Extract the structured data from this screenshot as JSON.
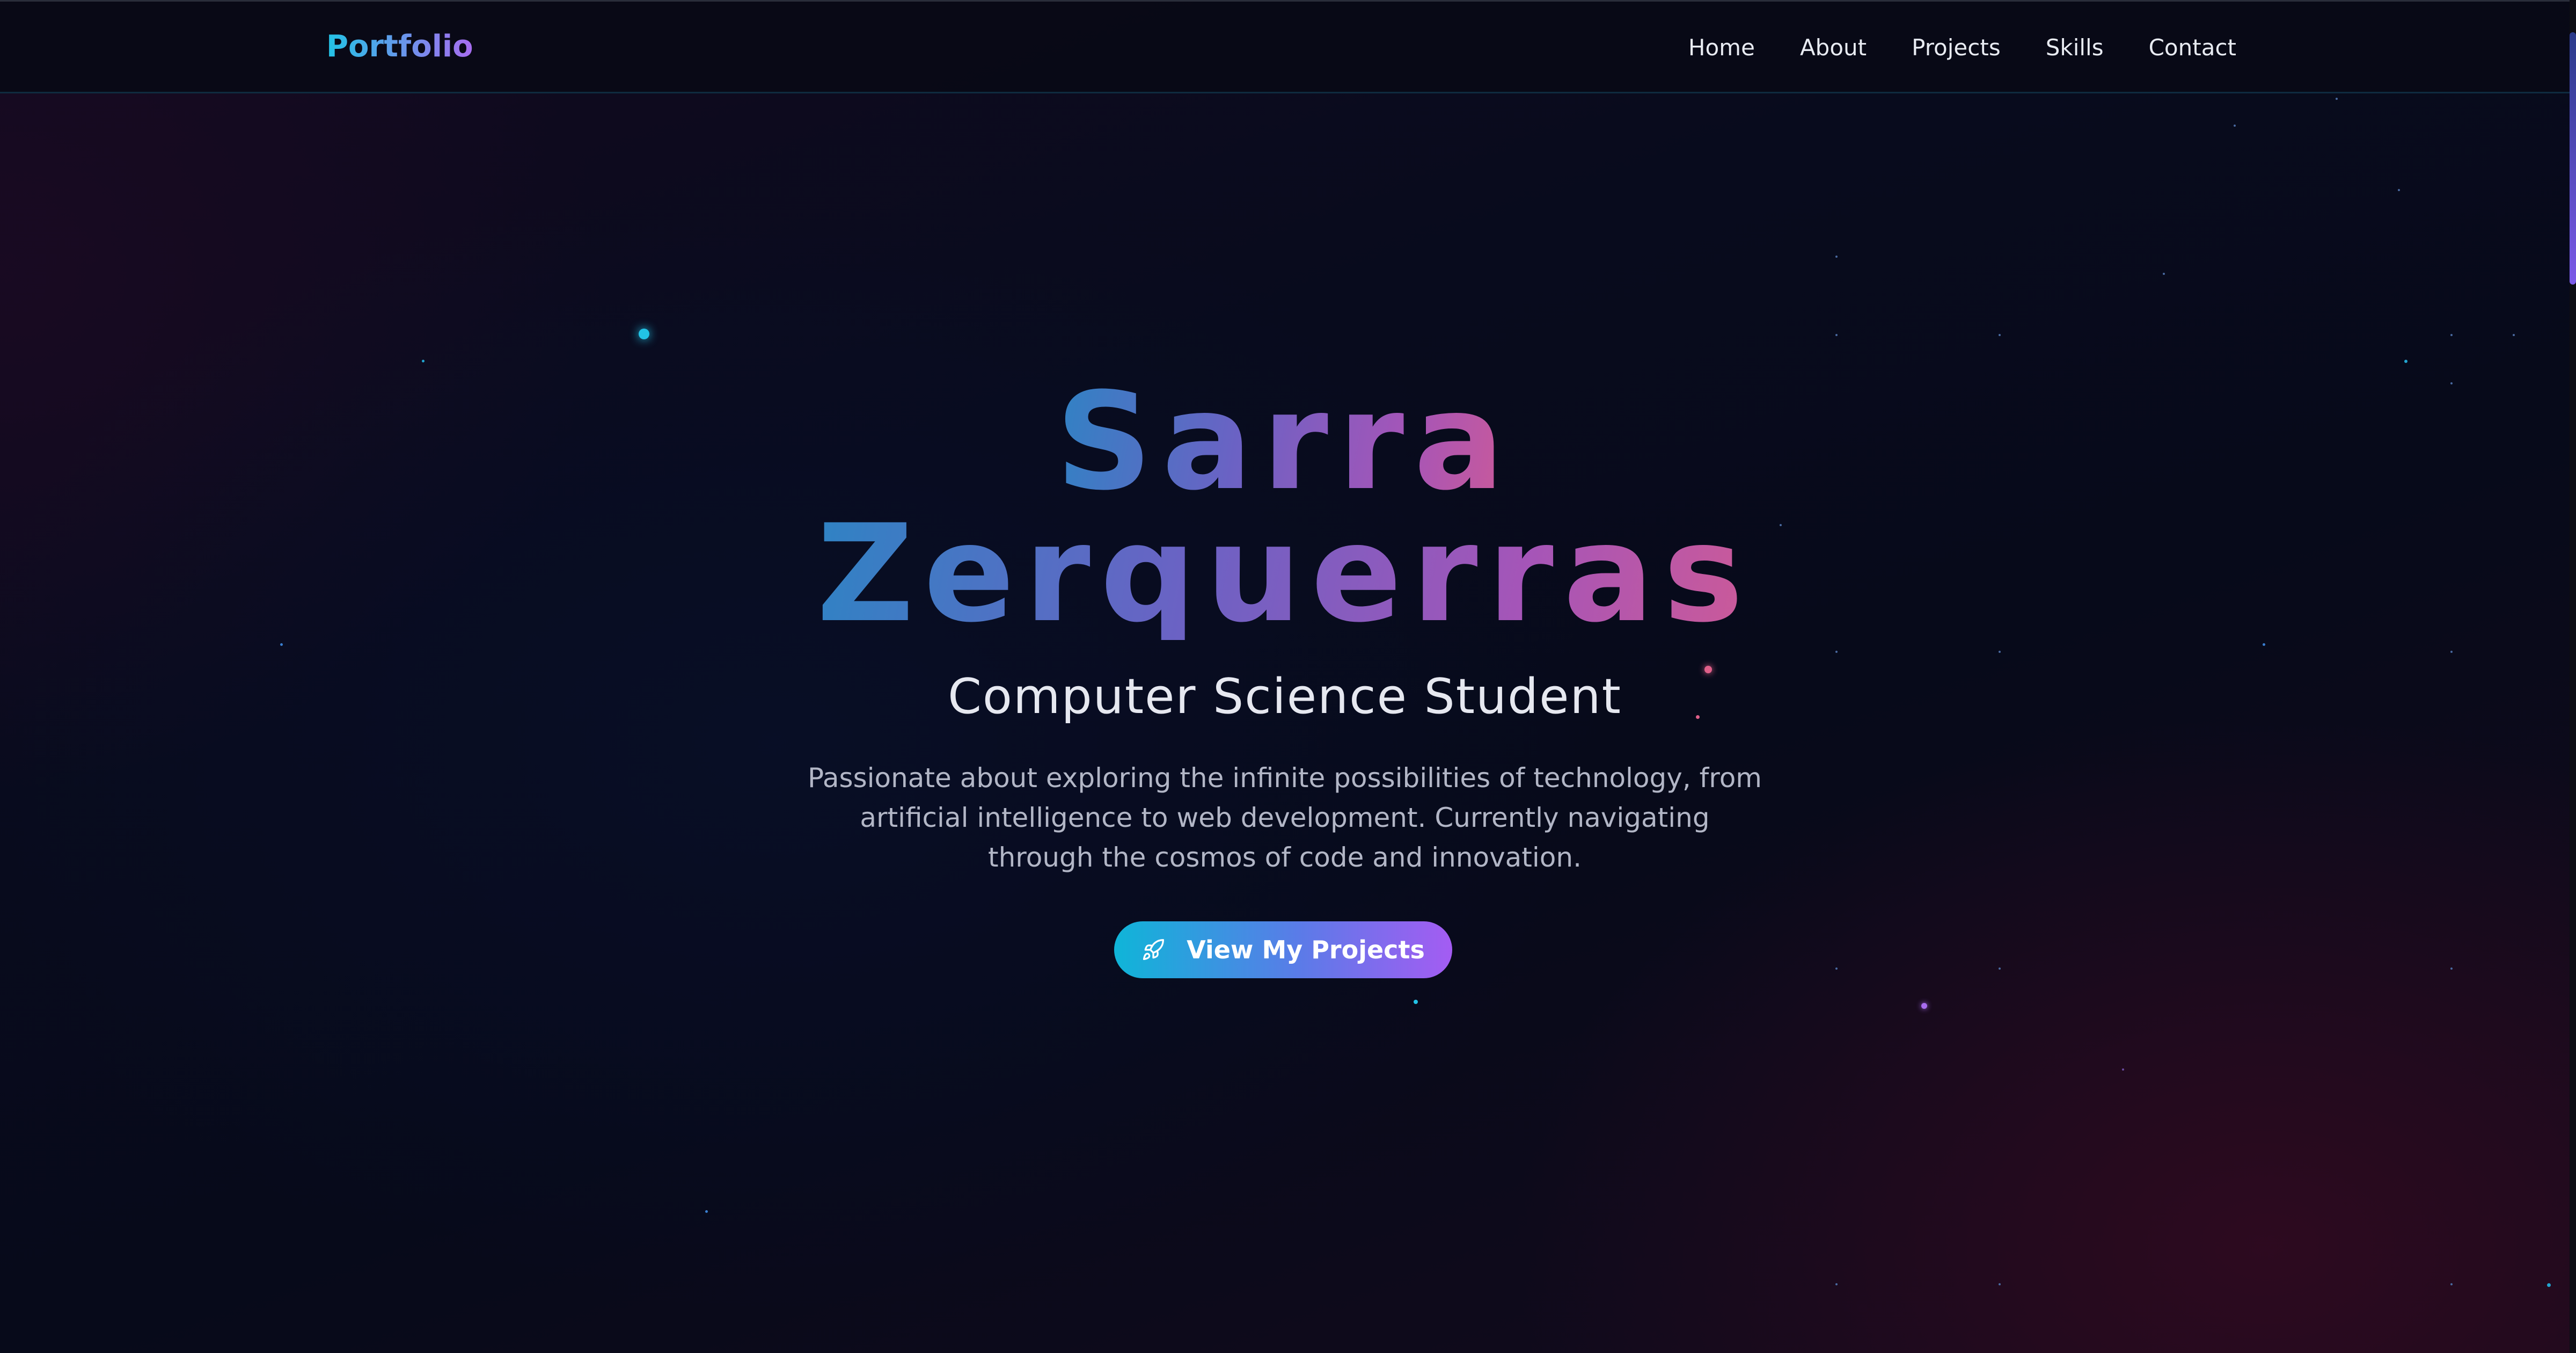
{
  "navbar": {
    "logo": "Portfolio",
    "links": [
      {
        "label": "Home"
      },
      {
        "label": "About"
      },
      {
        "label": "Projects"
      },
      {
        "label": "Skills"
      },
      {
        "label": "Contact"
      }
    ]
  },
  "hero": {
    "name_line1": "Sarra",
    "name_line2": "Zerquerras",
    "subtitle": "Computer Science Student",
    "description": "Passionate about exploring the infinite possibilities of technology, from artificial intelligence to web development. Currently navigating through the cosmos of code and innovation.",
    "cta": {
      "label": "View My Projects",
      "icon": "rocket-icon"
    }
  },
  "colors": {
    "accent_cyan": "#22c3e6",
    "accent_purple": "#a86cf0",
    "accent_pink": "#cc5a98",
    "background": "#08091a"
  }
}
